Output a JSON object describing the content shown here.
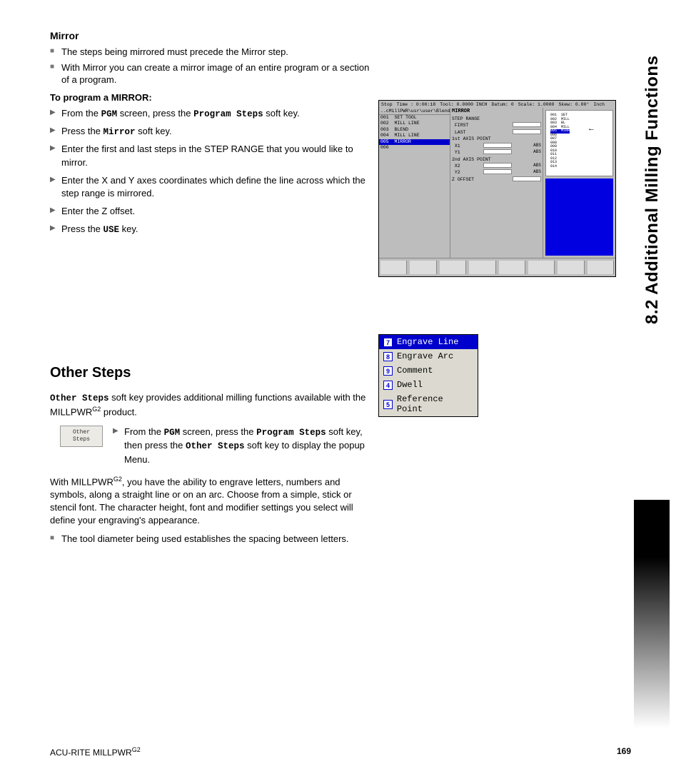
{
  "sideTitle": "8.2 Additional Milling Functions",
  "mirror": {
    "heading": "Mirror",
    "bullets_sq": [
      "The steps being mirrored must precede the Mirror step.",
      "With Mirror you can create a mirror image of an entire program or a section of a program."
    ],
    "toProgram": "To program a MIRROR:",
    "step1_a": "From the ",
    "step1_pgm": "PGM",
    "step1_b": " screen, press the ",
    "step1_ps": "Program Steps",
    "step1_c": " soft key.",
    "step2_a": "Press the ",
    "step2_mirror": "Mirror",
    "step2_b": " soft key.",
    "step3": "Enter the first and last steps in the STEP RANGE that you would like to mirror.",
    "step4": "Enter the X and Y axes coordinates which define the line across which the step range is mirrored.",
    "step5": "Enter the Z offset.",
    "step6_a": "Press the ",
    "step6_use": "USE",
    "step6_b": " key."
  },
  "otherSteps": {
    "heading": "Other Steps",
    "intro_a": "Other Steps",
    "intro_b": " soft key provides additional milling functions available with the MILLPWR",
    "intro_sup": "G2",
    "intro_c": " product.",
    "softkey_label": "Other\nSteps",
    "sk_a": "From the ",
    "sk_pgm": "PGM",
    "sk_b": " screen, press the ",
    "sk_ps": "Program Steps",
    "sk_c": " soft key, then press the ",
    "sk_os": "Other Steps",
    "sk_d": " soft key to display the popup Menu.",
    "para2_a": "With MILLPWR",
    "para2_sup": "G2",
    "para2_b": ", you have the ability to engrave letters, numbers and symbols, along a straight line or on an arc. Choose from a simple, stick or stencil font. The character height, font and modifier settings you select will define your engraving's appearance.",
    "bullet_sq": "The tool diameter being used establishes the spacing between letters."
  },
  "shot1": {
    "top": {
      "stop": "Stop",
      "time": "Time : 0:00:18",
      "tool": "Tool: 0.0000 INCH",
      "datum": "Datum: 0",
      "scale": "Scale: 1.0000",
      "skew": "Skew: 0.00°",
      "unit": "Inch"
    },
    "path": "..cMillPWR\\usr\\user\\Blend.mpt",
    "rows": [
      {
        "n": "001",
        "t": "SET TOOL"
      },
      {
        "n": "002",
        "t": "MILL LINE"
      },
      {
        "n": "003",
        "t": "BLEND"
      },
      {
        "n": "004",
        "t": "MILL LINE"
      },
      {
        "n": "005",
        "t": "MIRROR",
        "sel": true
      },
      {
        "n": "006",
        "t": ""
      }
    ],
    "mid": {
      "hdr": "MIRROR",
      "lines": [
        {
          "l": "STEP RANGE"
        },
        {
          "l": " FIRST",
          "f": true
        },
        {
          "l": " LAST",
          "f": true
        },
        {
          "l": "1st AXIS POINT"
        },
        {
          "l": " X1",
          "f": true,
          "r": "ABS"
        },
        {
          "l": " Y1",
          "f": true,
          "r": "ABS"
        },
        {
          "l": "2nd AXIS POINT"
        },
        {
          "l": " X2",
          "f": true,
          "r": "ABS"
        },
        {
          "l": " Y2",
          "f": true,
          "r": "ABS"
        },
        {
          "l": "Z OFFSET",
          "f": true
        }
      ]
    },
    "mini": [
      "001  SET",
      "002  MILL",
      "003  BL",
      "004  MILL",
      "005  MIRR",
      "006",
      "007",
      "008",
      "009",
      "010",
      "011",
      "012",
      "013",
      "014"
    ]
  },
  "popup": {
    "items": [
      {
        "n": "7",
        "label": "Engrave Line",
        "sel": true
      },
      {
        "n": "8",
        "label": "Engrave Arc"
      },
      {
        "n": "9",
        "label": "Comment"
      },
      {
        "n": "4",
        "label": "Dwell"
      },
      {
        "n": "5",
        "label": "Reference Point"
      }
    ]
  },
  "footer": {
    "left_a": "ACU-RITE MILLPWR",
    "left_sup": "G2",
    "page": "169"
  }
}
